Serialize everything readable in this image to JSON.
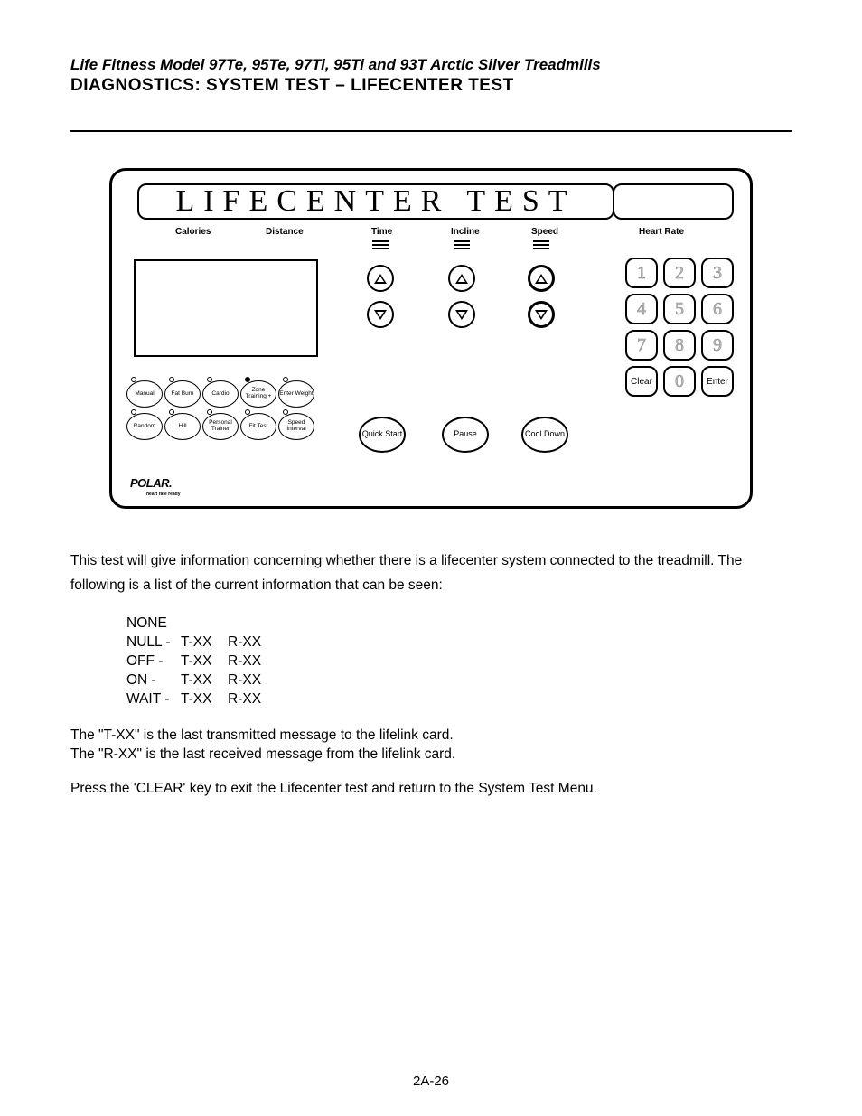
{
  "header": {
    "subtitle": "Life Fitness Model 97Te, 95Te, 97Ti, 95Ti and 93T Arctic Silver Treadmills",
    "title": "DIAGNOSTICS: SYSTEM TEST – LIFECENTER TEST"
  },
  "panel": {
    "lcd_text": "LIFECENTER TEST",
    "labels": {
      "calories": "Calories",
      "distance": "Distance",
      "time": "Time",
      "incline": "Incline",
      "speed": "Speed",
      "heart_rate": "Heart Rate"
    },
    "program_row1": [
      "Manual",
      "Fat Burn",
      "Cardio",
      "Zone Training +",
      "Enter Weight"
    ],
    "program_row2": [
      "Random",
      "Hill",
      "Personal Trainer",
      "Fit Test",
      "Speed Interval"
    ],
    "ovals": {
      "quick_start": "Quick Start",
      "pause": "Pause",
      "cool_down": "Cool Down"
    },
    "keypad": {
      "r1": [
        "1",
        "2",
        "3"
      ],
      "r2": [
        "4",
        "5",
        "6"
      ],
      "r3": [
        "7",
        "8",
        "9"
      ],
      "r4": [
        "Clear",
        "0",
        "Enter"
      ]
    },
    "polar": "POLAR.",
    "polar_sub": "heart rate ready"
  },
  "body": {
    "intro1": "This test will give information concerning whether there is a lifecenter system connected to the treadmill. The",
    "intro2": "following is a list of the current information that can be seen:",
    "rows": [
      [
        "NONE",
        "",
        ""
      ],
      [
        "NULL -",
        "T-XX",
        "R-XX"
      ],
      [
        "OFF -",
        "T-XX",
        "R-XX"
      ],
      [
        "ON  -",
        "T-XX",
        "R-XX"
      ],
      [
        "WAIT -",
        "T-XX",
        "R-XX"
      ]
    ],
    "explain1": "The \"T-XX\" is the last transmitted message to the lifelink card.",
    "explain2": "The \"R-XX\" is the last received message from the lifelink card.",
    "press": "Press the 'CLEAR' key to exit the Lifecenter test and return to the System Test Menu."
  },
  "footer": {
    "page": "2A-26"
  }
}
